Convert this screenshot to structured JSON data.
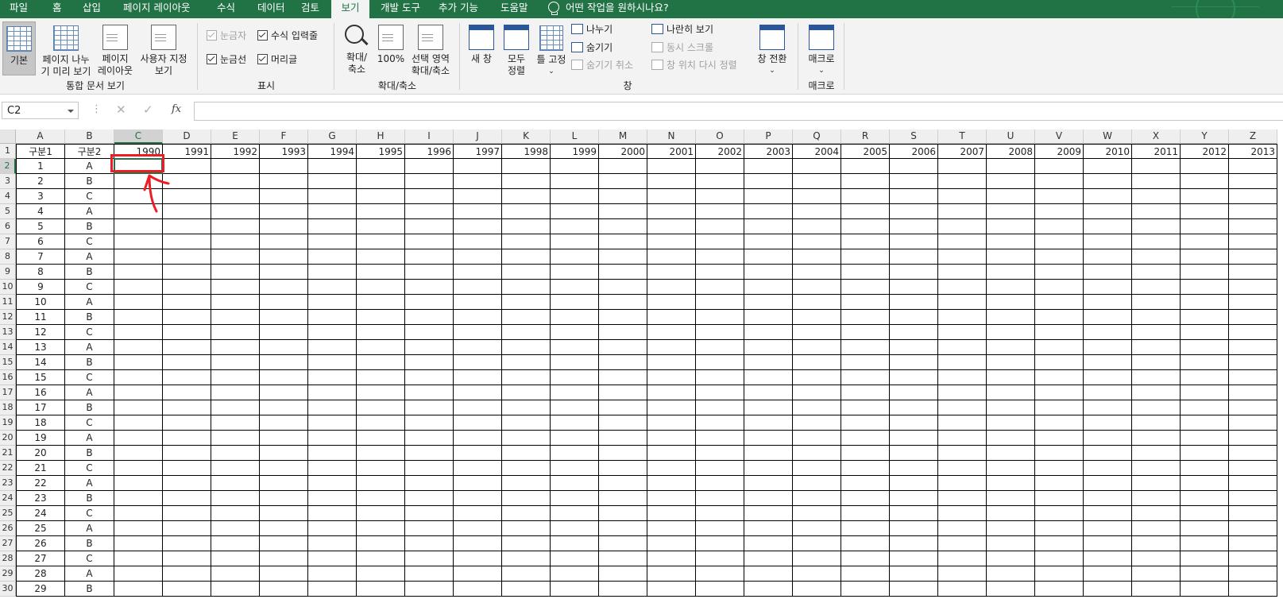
{
  "tabs": [
    {
      "label": "파일",
      "active": false
    },
    {
      "label": "홈",
      "active": false
    },
    {
      "label": "삽입",
      "active": false
    },
    {
      "label": "페이지 레이아웃",
      "active": false
    },
    {
      "label": "수식",
      "active": false
    },
    {
      "label": "데이터",
      "active": false
    },
    {
      "label": "검토",
      "active": false
    },
    {
      "label": "보기",
      "active": true
    },
    {
      "label": "개발 도구",
      "active": false
    },
    {
      "label": "추가 기능",
      "active": false
    },
    {
      "label": "도움말",
      "active": false
    }
  ],
  "tell_me": "어떤 작업을 원하시나요?",
  "ribbon": {
    "workbook_views": {
      "group_label": "통합 문서 보기",
      "normal": "기본",
      "page_break_1": "페이지 나누",
      "page_break_2": "기 미리 보기",
      "page_layout_1": "페이지",
      "page_layout_2": "레이아웃",
      "custom_1": "사용자 지정",
      "custom_2": "보기"
    },
    "show": {
      "group_label": "표시",
      "ruler": "눈금자",
      "formula_bar": "수식 입력줄",
      "gridlines": "눈금선",
      "headings": "머리글"
    },
    "zoom": {
      "group_label": "확대/축소",
      "zoom_1": "확대/",
      "zoom_2": "축소",
      "zoom100": "100%",
      "zoom_sel_1": "선택 영역",
      "zoom_sel_2": "확대/축소"
    },
    "window": {
      "group_label": "창",
      "new_window": "새 창",
      "arrange_1": "모두",
      "arrange_2": "정렬",
      "freeze": "틀 고정",
      "split": "나누기",
      "hide": "숨기기",
      "unhide": "숨기기 취소",
      "side_by_side": "나란히 보기",
      "sync_scroll": "동시 스크롤",
      "reset_position": "창 위치 다시 정렬",
      "switch": "창 전환"
    },
    "macros": {
      "group_label": "매크로",
      "macros": "매크로"
    }
  },
  "formula_bar": {
    "name_box": "C2",
    "fx": "fx",
    "cancel": "✕",
    "enter": "✓",
    "value": ""
  },
  "sheet": {
    "columns": [
      "A",
      "B",
      "C",
      "D",
      "E",
      "F",
      "G",
      "H",
      "I",
      "J",
      "K",
      "L",
      "M",
      "N",
      "O",
      "P",
      "Q",
      "R",
      "S",
      "T",
      "U",
      "V",
      "W",
      "X",
      "Y",
      "Z"
    ],
    "header_row": [
      "구분1",
      "구분2",
      "1990",
      "1991",
      "1992",
      "1993",
      "1994",
      "1995",
      "1996",
      "1997",
      "1998",
      "1999",
      "2000",
      "2001",
      "2002",
      "2003",
      "2004",
      "2005",
      "2006",
      "2007",
      "2008",
      "2009",
      "2010",
      "2011",
      "2012",
      "2013"
    ],
    "rows": [
      [
        "1",
        "A"
      ],
      [
        "2",
        "B"
      ],
      [
        "3",
        "C"
      ],
      [
        "4",
        "A"
      ],
      [
        "5",
        "B"
      ],
      [
        "6",
        "C"
      ],
      [
        "7",
        "A"
      ],
      [
        "8",
        "B"
      ],
      [
        "9",
        "C"
      ],
      [
        "10",
        "A"
      ],
      [
        "11",
        "B"
      ],
      [
        "12",
        "C"
      ],
      [
        "13",
        "A"
      ],
      [
        "14",
        "B"
      ],
      [
        "15",
        "C"
      ],
      [
        "16",
        "A"
      ],
      [
        "17",
        "B"
      ],
      [
        "18",
        "C"
      ],
      [
        "19",
        "A"
      ],
      [
        "20",
        "B"
      ],
      [
        "21",
        "C"
      ],
      [
        "22",
        "A"
      ],
      [
        "23",
        "B"
      ],
      [
        "24",
        "C"
      ],
      [
        "25",
        "A"
      ],
      [
        "26",
        "B"
      ],
      [
        "27",
        "C"
      ],
      [
        "28",
        "A"
      ],
      [
        "29",
        "B"
      ]
    ],
    "row_numbers": [
      "1",
      "2",
      "3",
      "4",
      "5",
      "6",
      "7",
      "8",
      "9",
      "10",
      "11",
      "12",
      "13",
      "14",
      "15",
      "16",
      "17",
      "18",
      "19",
      "20",
      "21",
      "22",
      "23",
      "24",
      "25",
      "26",
      "27",
      "28",
      "29",
      "30"
    ],
    "selected_cell": "C2",
    "annotation_color": "#ee1c24",
    "accent_color": "#217346"
  }
}
